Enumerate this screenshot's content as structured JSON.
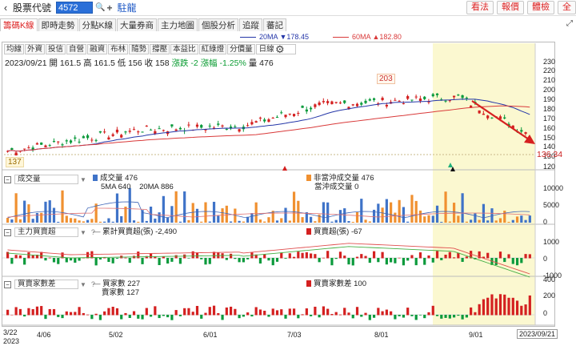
{
  "topbar": {
    "back_icon": "‹",
    "stock_label": "股票代號",
    "stock_code": "4572",
    "stock_name": "駐龍",
    "buttons": [
      "看法",
      "報價",
      "體檢",
      "全"
    ]
  },
  "tabs": [
    "籌碼K線",
    "即時走勢",
    "分點K線",
    "大量券商",
    "主力地圖",
    "個股分析",
    "追蹤",
    "蕃記"
  ],
  "active_tab": 0,
  "ma_legend": [
    {
      "label": "20MA ▼178.45",
      "color": "#2436a8"
    },
    {
      "label": "60MA ▲182.80",
      "color": "#d93a3a"
    }
  ],
  "indicator_buttons": [
    "均線",
    "外資",
    "投信",
    "自營",
    "融資",
    "布林",
    "隨勢",
    "撐壓",
    "本益比",
    "紅綠燈",
    "分價量"
  ],
  "period_select": "日線",
  "quote": {
    "date": "2023/09/21",
    "open": "開 161.5",
    "high": "高 161.5",
    "low": "低 156",
    "close": "收 158",
    "change": "漲跌 -2",
    "pct": "漲幅 -1.25%",
    "volume": "量 476"
  },
  "price_axis": [
    "230",
    "220",
    "210",
    "200",
    "190",
    "180",
    "170",
    "160",
    "150",
    "140",
    "130",
    "120"
  ],
  "price_tags": {
    "high": "203",
    "low": "137",
    "current": "136.34"
  },
  "volume_pane": {
    "name": "成交量",
    "legend": [
      "成交量 476",
      "5MA 640",
      "20MA 886"
    ],
    "legend_right": [
      "非當沖成交量 476",
      "當沖成交量 0"
    ],
    "axis": [
      "10000",
      "5000",
      "0"
    ]
  },
  "main_force_pane": {
    "name": "主力買賣超",
    "legend": "累計買賣超(張) -2,490",
    "legend_right": "買賣超(張) -67",
    "axis": [
      "1000",
      "0",
      "-1000"
    ]
  },
  "buyer_pane": {
    "name": "買賣家數差",
    "legend": [
      "買家數 227",
      "賣家數 127"
    ],
    "legend_right": "買賣家數差 100",
    "axis": [
      "400",
      "200",
      "0"
    ]
  },
  "dates": [
    "3/22",
    "2023",
    "4/06",
    "5/02",
    "6/01",
    "7/03",
    "8/01",
    "9/01",
    "2023/09/21"
  ],
  "colors": {
    "up": "#d42020",
    "down": "#0b9a3c",
    "ma20": "#2436a8",
    "ma60": "#d93a3a",
    "highlight": "#fbf8d0",
    "blue_vol": "#3f73c8",
    "orange_vol": "#f09030"
  },
  "icons": {
    "search": "search-icon",
    "gear": "gear-icon",
    "plus": "plus-icon"
  }
}
